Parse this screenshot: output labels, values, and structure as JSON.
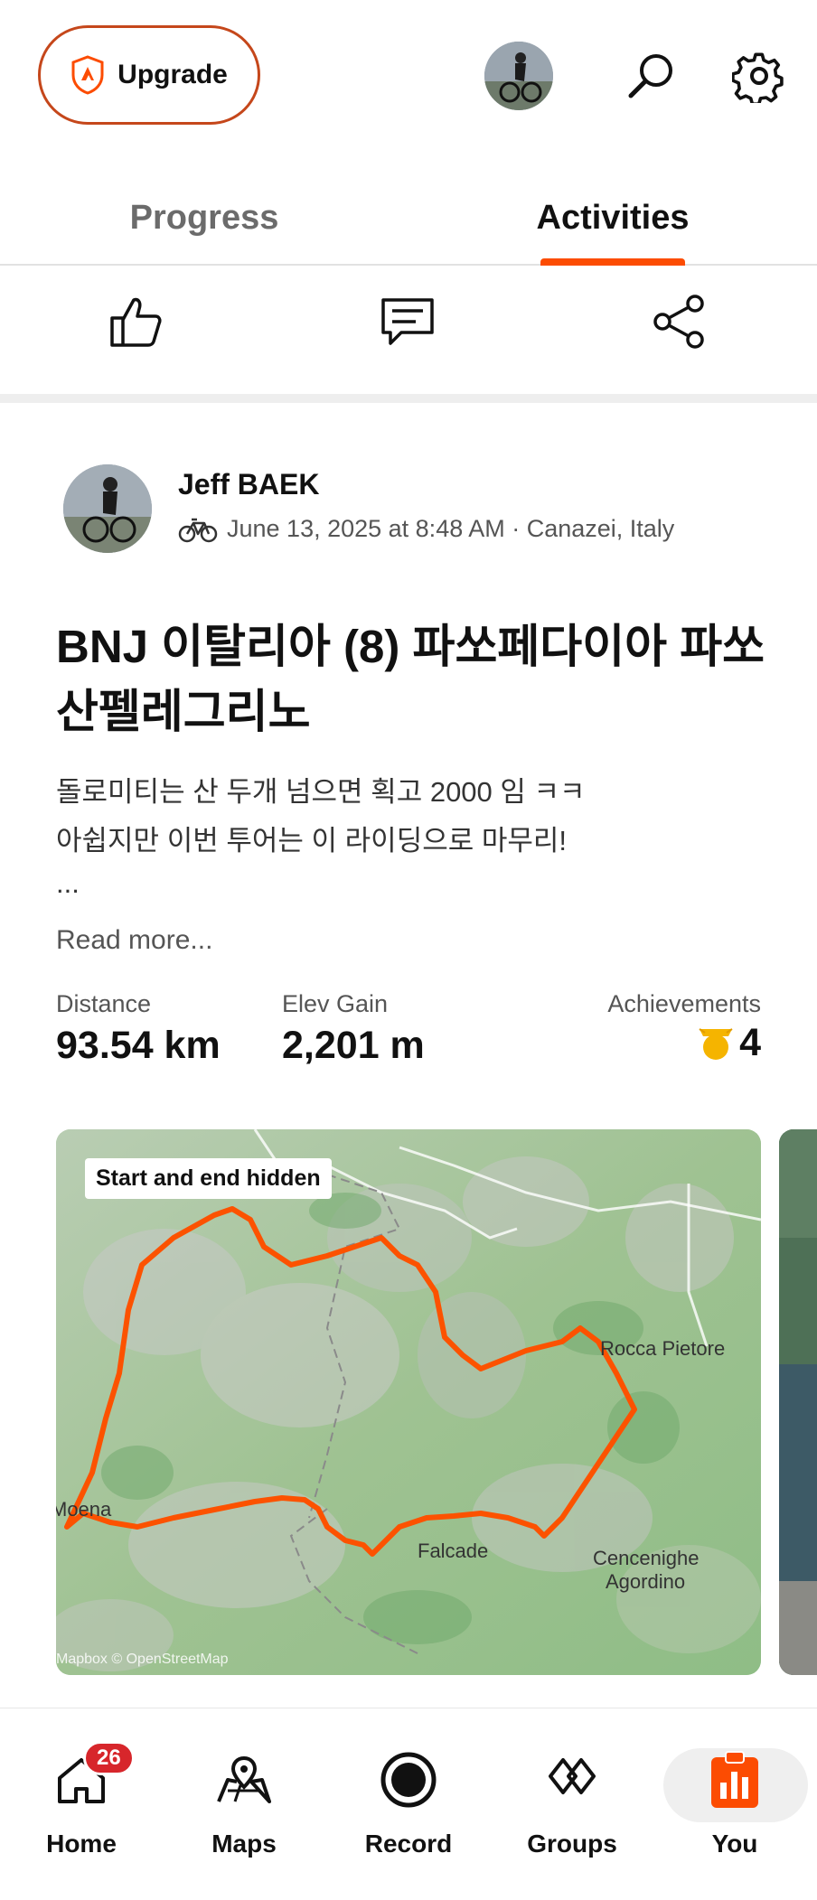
{
  "header": {
    "upgrade_label": "Upgrade"
  },
  "tabs": [
    {
      "label": "Progress",
      "selected": false
    },
    {
      "label": "Activities",
      "selected": true
    }
  ],
  "activity": {
    "athlete_name": "Jeff BAEK",
    "activity_type_icon": "bike-icon",
    "meta": "June 13, 2025 at 8:48 AM · Canazei, Italy",
    "title": "BNJ 이탈리아 (8) 파쏘페다이아 파쏘산펠레그리노",
    "description_line1": "돌로미티는 산 두개 넘으면 획고 2000 임 ㅋㅋ",
    "description_line2": "아쉽지만 이번 투어는 이 라이딩으로 마무리!",
    "description_ellipsis": "...",
    "read_more": "Read more...",
    "stats": {
      "distance_label": "Distance",
      "distance_value": "93.54 km",
      "elev_label": "Elev Gain",
      "elev_value": "2,201 m",
      "achievements_label": "Achievements",
      "achievements_value": "4"
    },
    "map": {
      "badge": "Start and end hidden",
      "attribution": "Mapbox © OpenStreetMap",
      "place_rocca": "Rocca Pietore",
      "place_falcade": "Falcade",
      "place_cencenighe": "Cencenighe",
      "place_agordino": "Agordino",
      "place_moena": "Moena",
      "route_color": "#fc5200"
    }
  },
  "nav": {
    "home": "Home",
    "home_badge": "26",
    "maps": "Maps",
    "record": "Record",
    "groups": "Groups",
    "you": "You"
  },
  "colors": {
    "accent": "#fc4c02",
    "upgrade_border": "#c5471b",
    "badge": "#d7262b"
  }
}
